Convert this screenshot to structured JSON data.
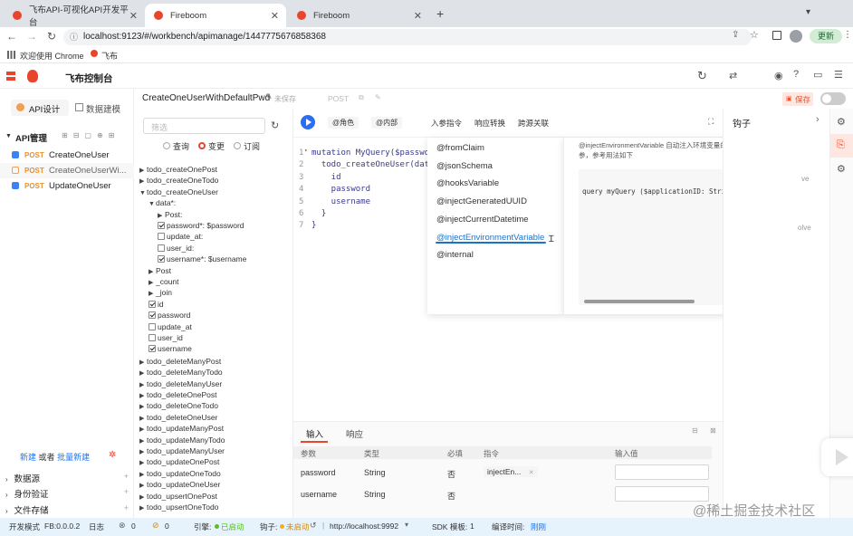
{
  "browser": {
    "tabs": [
      {
        "title": "飞布API-可视化API开发平台"
      },
      {
        "title": "Fireboom"
      },
      {
        "title": "Fireboom"
      }
    ],
    "url": "localhost:9123/#/workbench/apimanage/1447775676858368",
    "update_label": "更新",
    "bookmarks": [
      {
        "label": "欢迎使用 Chrome"
      },
      {
        "label": "飞布"
      }
    ]
  },
  "app": {
    "title": "飞布控制台"
  },
  "left": {
    "tabs": {
      "api_design": "API设计",
      "data_modeling": "数据建模"
    },
    "section": "API管理",
    "apis": [
      {
        "method": "POST",
        "name": "CreateOneUser"
      },
      {
        "method": "POST",
        "name": "CreateOneUserWi..."
      },
      {
        "method": "POST",
        "name": "UpdateOneUser"
      }
    ],
    "new_label": "新建",
    "or_label": "或者",
    "batch_label": "批量新建",
    "bottom_sections": [
      {
        "label": "数据源"
      },
      {
        "label": "身份验证"
      },
      {
        "label": "文件存储"
      }
    ]
  },
  "tree": {
    "filter_placeholder": "筛选",
    "modes": [
      {
        "label": "查询"
      },
      {
        "label": "变更"
      },
      {
        "label": "订阅"
      }
    ],
    "top_items": [
      "todo_createOnePost",
      "todo_createOneTodo",
      "todo_createOneUser"
    ],
    "data_label": "data*:",
    "data_children": [
      {
        "label": "Post:",
        "type": "arrow"
      },
      {
        "label": "password*: $password",
        "type": "check",
        "checked": true
      },
      {
        "label": "update_at:",
        "type": "check",
        "checked": false
      },
      {
        "label": "user_id:",
        "type": "check",
        "checked": false
      },
      {
        "label": "username*: $username",
        "type": "check",
        "checked": true
      }
    ],
    "mid_arrows": [
      "Post",
      "_count",
      "_join"
    ],
    "fields": [
      {
        "label": "id",
        "checked": true
      },
      {
        "label": "password",
        "checked": true
      },
      {
        "label": "update_at",
        "checked": false
      },
      {
        "label": "user_id",
        "checked": false
      },
      {
        "label": "username",
        "checked": true
      }
    ],
    "more_items": [
      "todo_deleteManyPost",
      "todo_deleteManyTodo",
      "todo_deleteManyUser",
      "todo_deleteOnePost",
      "todo_deleteOneTodo",
      "todo_deleteOneUser",
      "todo_updateManyPost",
      "todo_updateManyTodo",
      "todo_updateManyUser",
      "todo_updateOnePost",
      "todo_updateOneTodo",
      "todo_updateOneUser",
      "todo_upsertOnePost",
      "todo_upsertOneTodo"
    ]
  },
  "editor": {
    "title": "CreateOneUserWithDefaultPwd",
    "unsaved": "未保存",
    "method": "POST",
    "save_label": "保存",
    "toolbar": {
      "role": "@角色",
      "internal": "@内部",
      "inject": "入参指令",
      "resp_transform": "响应转换",
      "cross_source": "跨源关联"
    },
    "code_lines": [
      {
        "num": "1",
        "text": "mutation MyQuery($passwor"
      },
      {
        "num": "2",
        "text": "  todo_createOneUser(data"
      },
      {
        "num": "3",
        "text": "    id"
      },
      {
        "num": "4",
        "text": "    password"
      },
      {
        "num": "5",
        "text": "    username"
      },
      {
        "num": "6",
        "text": "  }"
      },
      {
        "num": "7",
        "text": "}"
      }
    ],
    "directives": [
      {
        "label": "@fromClaim"
      },
      {
        "label": "@jsonSchema"
      },
      {
        "label": "@hooksVariable"
      },
      {
        "label": "@injectGeneratedUUID"
      },
      {
        "label": "@injectCurrentDatetime"
      },
      {
        "label": "@injectEnvironmentVariable"
      },
      {
        "label": "@internal"
      }
    ],
    "directive_desc": "@injectEnvironmentVariable 自动注入环境变量的值，用户无需传参，参考用法如下",
    "directive_example": "query myQuery ($applicationID: String! @injectEnv",
    "bottom_tabs": {
      "input": "输入",
      "response": "响应"
    },
    "table": {
      "headers": [
        "参数",
        "类型",
        "必填",
        "指令",
        "输入值"
      ],
      "rows": [
        {
          "param": "password",
          "type": "String",
          "required": "否",
          "directive": "injectEn..."
        },
        {
          "param": "username",
          "type": "String",
          "required": "否",
          "directive": ""
        }
      ]
    }
  },
  "hooks": {
    "title": "钩子",
    "frag1": "ve",
    "frag2": "olve"
  },
  "status": {
    "mode": "开发模式",
    "version": "FB:0.0.0.2",
    "log": "日志",
    "errors": "0",
    "warnings": "0",
    "engine_label": "引擎:",
    "engine_state": "已启动",
    "hooks_label": "钩子:",
    "hooks_state": "未启动",
    "server_url": "http://localhost:9992",
    "sdk_label": "SDK 模板:",
    "sdk_value": "1",
    "compile_label": "编译时间:",
    "compile_value": "刚刚"
  },
  "watermark": "@稀土掘金技术社区",
  "colors": {
    "accent": "#f0552e",
    "brand_blue": "#1677ff",
    "status_bg": "#e6f2fc",
    "run_blue": "#2b6ef2"
  }
}
